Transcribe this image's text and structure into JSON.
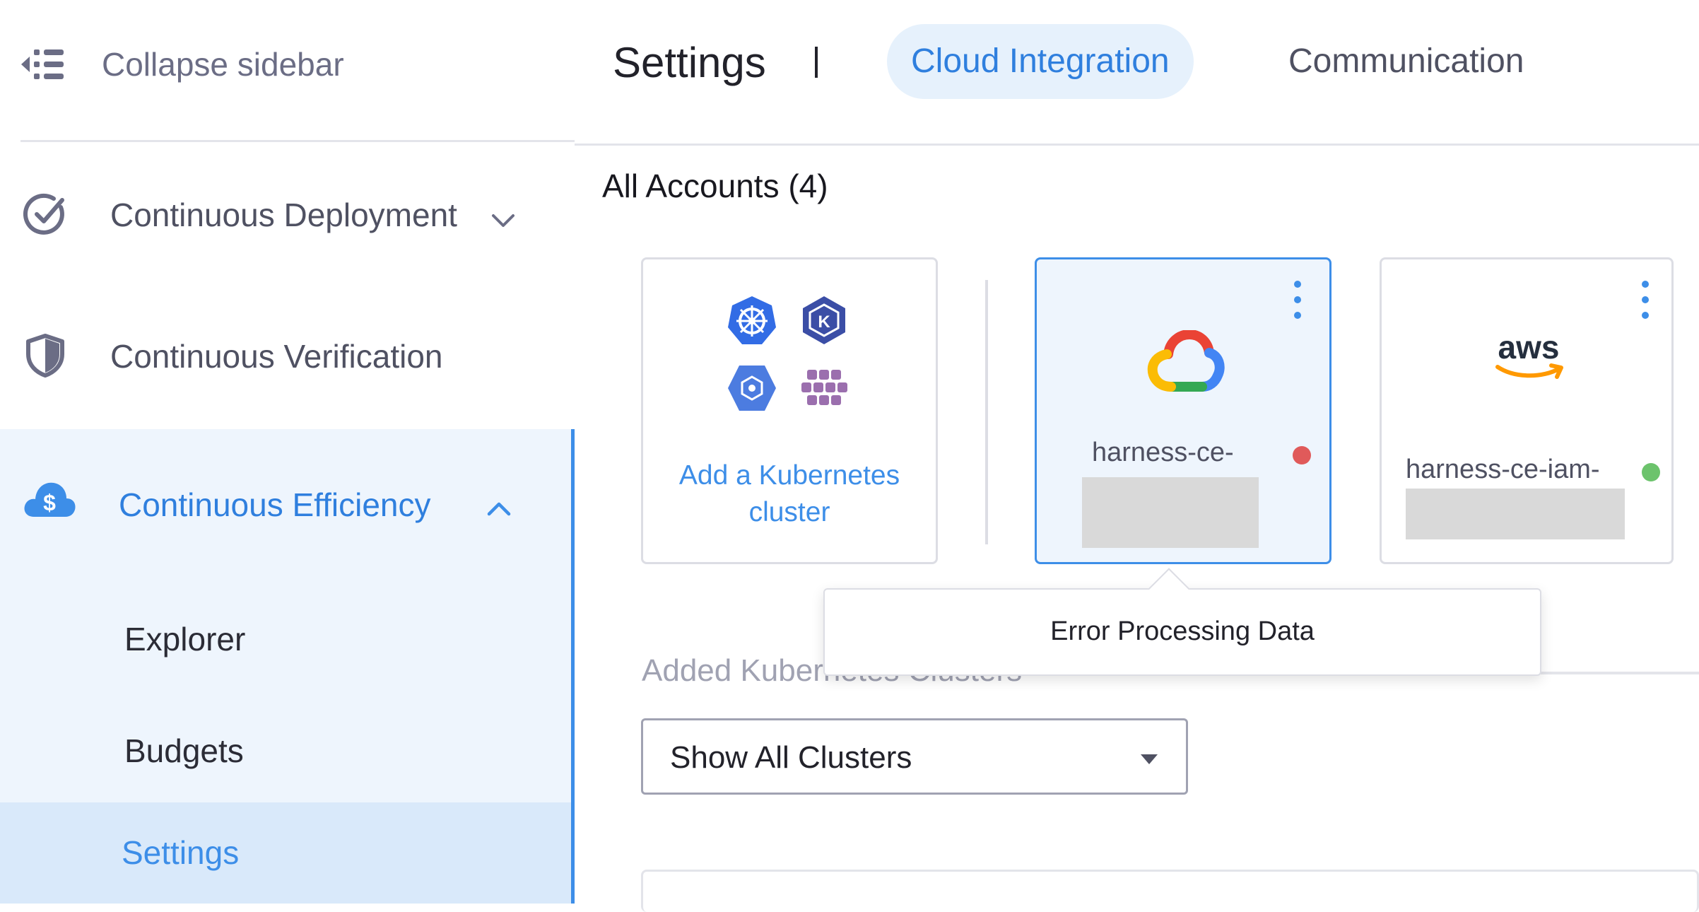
{
  "sidebar": {
    "collapse_label": "Collapse sidebar",
    "modules": [
      {
        "label": "Continuous Deployment",
        "icon": "check-circle-icon"
      },
      {
        "label": "Continuous Verification",
        "icon": "shield-icon"
      },
      {
        "label": "Continuous Efficiency",
        "icon": "cloud-dollar-icon"
      }
    ],
    "ce_items": [
      {
        "label": "Explorer"
      },
      {
        "label": "Budgets"
      },
      {
        "label": "Settings",
        "active": true
      }
    ]
  },
  "header": {
    "title": "Settings",
    "tabs": [
      {
        "label": "Cloud Integration",
        "active": true
      },
      {
        "label": "Communication"
      }
    ]
  },
  "accounts": {
    "title": "All Accounts (4)",
    "add_card_label": "Add a Kubernetes cluster",
    "cards": [
      {
        "name": "harness-ce-",
        "status": "error",
        "status_color": "#e05a5a",
        "icon": "gcp-icon"
      },
      {
        "name": "harness-ce-iam-",
        "status": "ok",
        "status_color": "#6cc36c",
        "icon": "aws-icon",
        "logo_text": "aws"
      }
    ]
  },
  "tooltip": {
    "text": "Error Processing Data"
  },
  "clusters": {
    "title": "Added Kubernetes Clusters",
    "filter_value": "Show All Clusters"
  },
  "colors": {
    "accent": "#3d8ee8",
    "panel": "#eef5fd"
  }
}
